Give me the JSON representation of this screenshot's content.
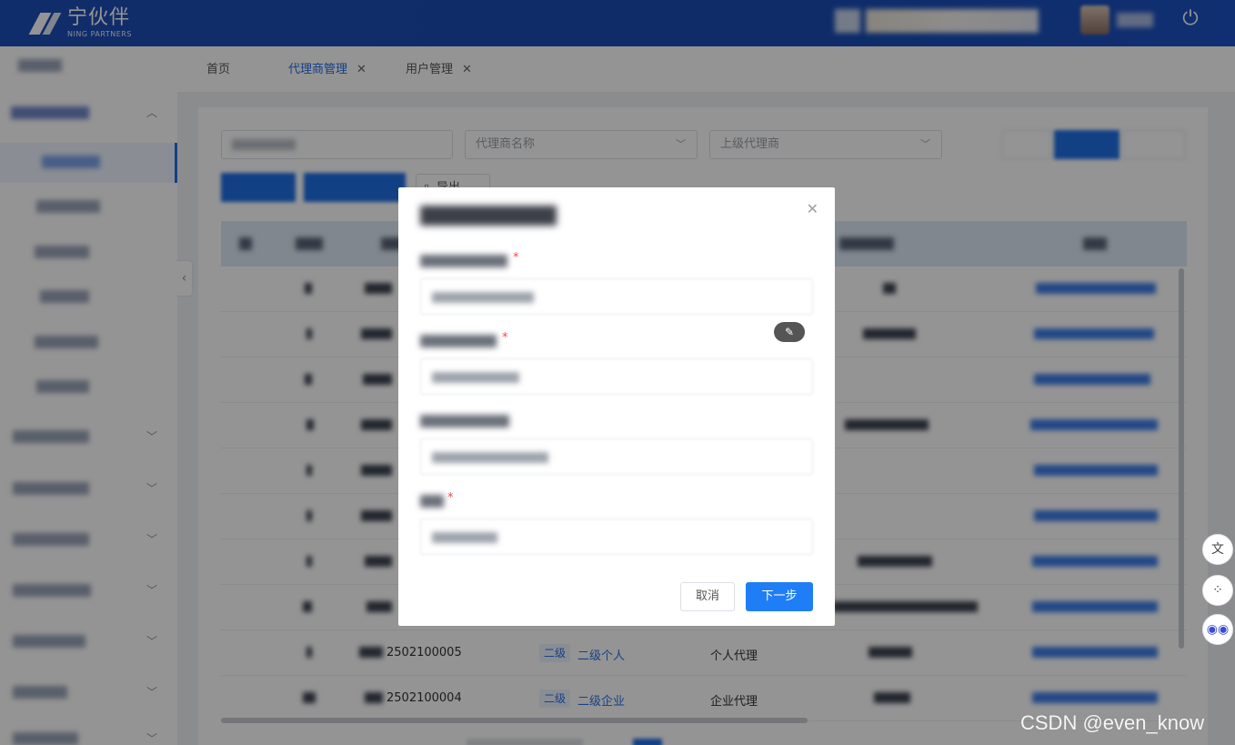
{
  "header": {
    "brand_cn": "宁伙伴",
    "brand_en": "NING PARTNERS",
    "power_icon": "power-icon"
  },
  "tabs": [
    {
      "label": "首页"
    },
    {
      "label": "代理商管理"
    },
    {
      "label": "用户管理"
    }
  ],
  "tab_close_glyph": "✕",
  "filters": {
    "agent_name_placeholder": "代理商名称",
    "parent_agent_placeholder": "上级代理商"
  },
  "toolbar": {
    "export_label": "导出"
  },
  "table": {
    "rows": [
      {
        "id": "2502100005",
        "level_tag": "二级",
        "level_name": "二级个人",
        "type": "个人代理"
      },
      {
        "id": "2502100004",
        "level_tag": "二级",
        "level_name": "二级企业",
        "type": "企业代理"
      }
    ]
  },
  "modal": {
    "cancel_label": "取消",
    "next_label": "下一步",
    "required_mark": "*"
  },
  "watermark": "CSDN @even_know",
  "colors": {
    "primary": "#1f6fe5",
    "header": "#1d4fb8",
    "required": "#f04848"
  }
}
